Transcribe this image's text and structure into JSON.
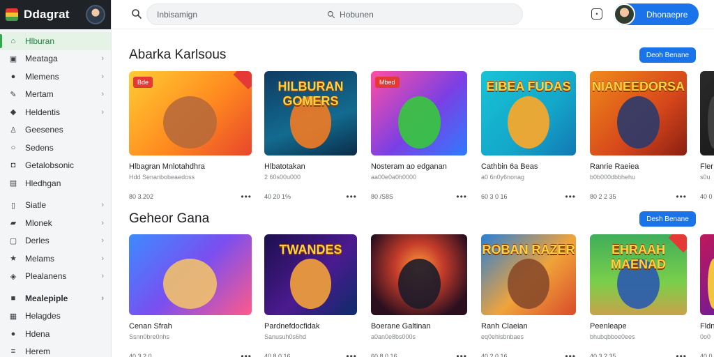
{
  "brand": {
    "name": "Ddagrat"
  },
  "sidebar": {
    "items": [
      {
        "label": "Hlburan",
        "icon": "home-icon",
        "glyph": "⌂",
        "chev": "",
        "active": true,
        "bold": false
      },
      {
        "label": "Meataga",
        "icon": "grid-icon",
        "glyph": "▣",
        "chev": "›",
        "active": false,
        "bold": false
      },
      {
        "label": "Mlemens",
        "icon": "user-icon",
        "glyph": "●",
        "chev": "›",
        "active": false,
        "bold": false
      },
      {
        "label": "Mertam",
        "icon": "edit-icon",
        "glyph": "✎",
        "chev": "›",
        "active": false,
        "bold": false
      },
      {
        "label": "Heldentis",
        "icon": "tag-icon",
        "glyph": "◆",
        "chev": "›",
        "active": false,
        "bold": false
      },
      {
        "label": "Geesenes",
        "icon": "person-icon",
        "glyph": "♙",
        "chev": "",
        "active": false,
        "bold": false
      },
      {
        "label": "Sedens",
        "icon": "circle-icon",
        "glyph": "○",
        "chev": "",
        "active": false,
        "bold": false
      },
      {
        "label": "Getalobsonic",
        "icon": "gamepad-icon",
        "glyph": "◘",
        "chev": "",
        "active": false,
        "bold": false
      },
      {
        "label": "Hledhgan",
        "icon": "image-icon",
        "glyph": "▤",
        "chev": "",
        "active": false,
        "bold": false
      },
      {
        "label": "Siatle",
        "icon": "doc-icon",
        "glyph": "▯",
        "chev": "›",
        "active": false,
        "bold": false,
        "sepBefore": true
      },
      {
        "label": "Mlonek",
        "icon": "folder-icon",
        "glyph": "▰",
        "chev": "›",
        "active": false,
        "bold": false
      },
      {
        "label": "Derles",
        "icon": "box-icon",
        "glyph": "▢",
        "chev": "›",
        "active": false,
        "bold": false
      },
      {
        "label": "Melams",
        "icon": "star-icon",
        "glyph": "★",
        "chev": "›",
        "active": false,
        "bold": false
      },
      {
        "label": "Plealanens",
        "icon": "shield-icon",
        "glyph": "◈",
        "chev": "›",
        "active": false,
        "bold": false
      },
      {
        "label": "Mealepiple",
        "icon": "store-icon",
        "glyph": "■",
        "chev": "›",
        "active": false,
        "bold": true,
        "sepBefore": true
      },
      {
        "label": "Helagdes",
        "icon": "list-icon",
        "glyph": "▦",
        "chev": "",
        "active": false,
        "bold": false
      },
      {
        "label": "Hdena",
        "icon": "account-icon",
        "glyph": "●",
        "chev": "",
        "active": false,
        "bold": false
      },
      {
        "label": "Herem",
        "icon": "menu-icon",
        "glyph": "≡",
        "chev": "",
        "active": false,
        "bold": false
      }
    ]
  },
  "search": {
    "text1": "Inbisamign",
    "text2": "Hobunen"
  },
  "user": {
    "name": "Dhonaepre"
  },
  "sections": [
    {
      "title": "Abarka Karlsous",
      "button": "Deoh Benane",
      "cards": [
        {
          "title": "Hlbagran Mnlotahdhra",
          "sub": "Hdd Senanbobeaedoss",
          "meta": "80 3.202",
          "thumbTitle": "",
          "badge": "Bde",
          "corner": true,
          "bg": "linear-gradient(135deg,#ffcc33 0%,#ff8a1f 55%,#e8462b 100%)",
          "char": "#b86a3a"
        },
        {
          "title": "Hlbatotakan",
          "sub": "2 60s00u000",
          "meta": "40 20 1%",
          "thumbTitle": "HILBURAN GOMERS",
          "badge": "",
          "corner": false,
          "bg": "linear-gradient(160deg,#0f3b63 0%,#126b8f 60%,#0b2c48 100%)",
          "char": "#f27b24"
        },
        {
          "title": "Nosteram ao edganan",
          "sub": "aa00e0a0h0000",
          "meta": "80 /S8S",
          "thumbTitle": "",
          "badge": "Mbed",
          "corner": false,
          "bg": "linear-gradient(135deg,#ff4fa3 0%,#7b3fe4 55%,#2f7bff 100%)",
          "char": "#36c93c"
        },
        {
          "title": "Cathbin 6a Beas",
          "sub": "a0 6n0y6nonag",
          "meta": "60 3 0 16",
          "thumbTitle": "EIBEA FUDAS",
          "badge": "",
          "corner": false,
          "bg": "linear-gradient(135deg,#17c3d6 0%,#14a6c9 60%,#1278b3 100%)",
          "char": "#ffa726"
        },
        {
          "title": "Ranrie Raeiea",
          "sub": "b0b000dbbhehu",
          "meta": "80 2 2 35",
          "thumbTitle": "NIANEEDORSA",
          "badge": "",
          "corner": false,
          "bg": "linear-gradient(135deg,#f08a1a 0%,#d6461b 60%,#8a1f12 100%)",
          "char": "#2b3a6b"
        },
        {
          "title": "Fler",
          "sub": "s0u",
          "meta": "40 0",
          "thumbTitle": "",
          "badge": "",
          "corner": false,
          "bg": "linear-gradient(135deg,#2a2a2a 0%,#1a1a1a 100%)",
          "char": "#444"
        }
      ]
    },
    {
      "title": "Geheor Gana",
      "button": "Desh Benane",
      "cards": [
        {
          "title": "Cenan Sfrah",
          "sub": "Ssnn0bre0nhs",
          "meta": "40 3 2 0",
          "thumbTitle": "",
          "badge": "",
          "corner": false,
          "bg": "linear-gradient(135deg,#3d8bff 0%,#7a4ff0 50%,#ff5a8a 100%)",
          "char": "#f1c06b"
        },
        {
          "title": "Pardnefdocfidak",
          "sub": "Sanusuh0s6hd",
          "meta": "40 8 0 16",
          "thumbTitle": "TWANDES",
          "badge": "",
          "corner": false,
          "bg": "linear-gradient(135deg,#1b0f4d 0%,#4b1a8f 55%,#0d2b6b 100%)",
          "char": "#f4a23a"
        },
        {
          "title": "Boerane Galtinan",
          "sub": "a0an0e8bs000s",
          "meta": "60 8 0 16",
          "thumbTitle": "",
          "badge": "",
          "corner": false,
          "bg": "radial-gradient(circle at 50% 40%,#ff9a3c 0%,#c43c2a 35%,#2a0f1f 80%)",
          "char": "#1c1c2a"
        },
        {
          "title": "Ranh Claeian",
          "sub": "eq0ehlsbnbaes",
          "meta": "40 2 0 16",
          "thumbTitle": "ROBAN RAZER",
          "badge": "",
          "corner": false,
          "bg": "linear-gradient(135deg,#2a7fd4 0%,#f0a43a 55%,#d94b2a 100%)",
          "char": "#8a4a2a"
        },
        {
          "title": "Peenleape",
          "sub": "bhubqbboe0ees",
          "meta": "40 3 2 35",
          "thumbTitle": "EHRAAH MAENAD",
          "badge": "",
          "corner": true,
          "bg": "linear-gradient(180deg,#3fae5a 0%,#7bcf4a 60%,#c9a24a 100%)",
          "char": "#2a5ab0"
        },
        {
          "title": "Fldn",
          "sub": "0o0",
          "meta": "40 0",
          "thumbTitle": "",
          "badge": "",
          "corner": false,
          "bg": "linear-gradient(135deg,#c2185b 0%,#6a1b9a 100%)",
          "char": "#fdd835"
        }
      ]
    }
  ]
}
